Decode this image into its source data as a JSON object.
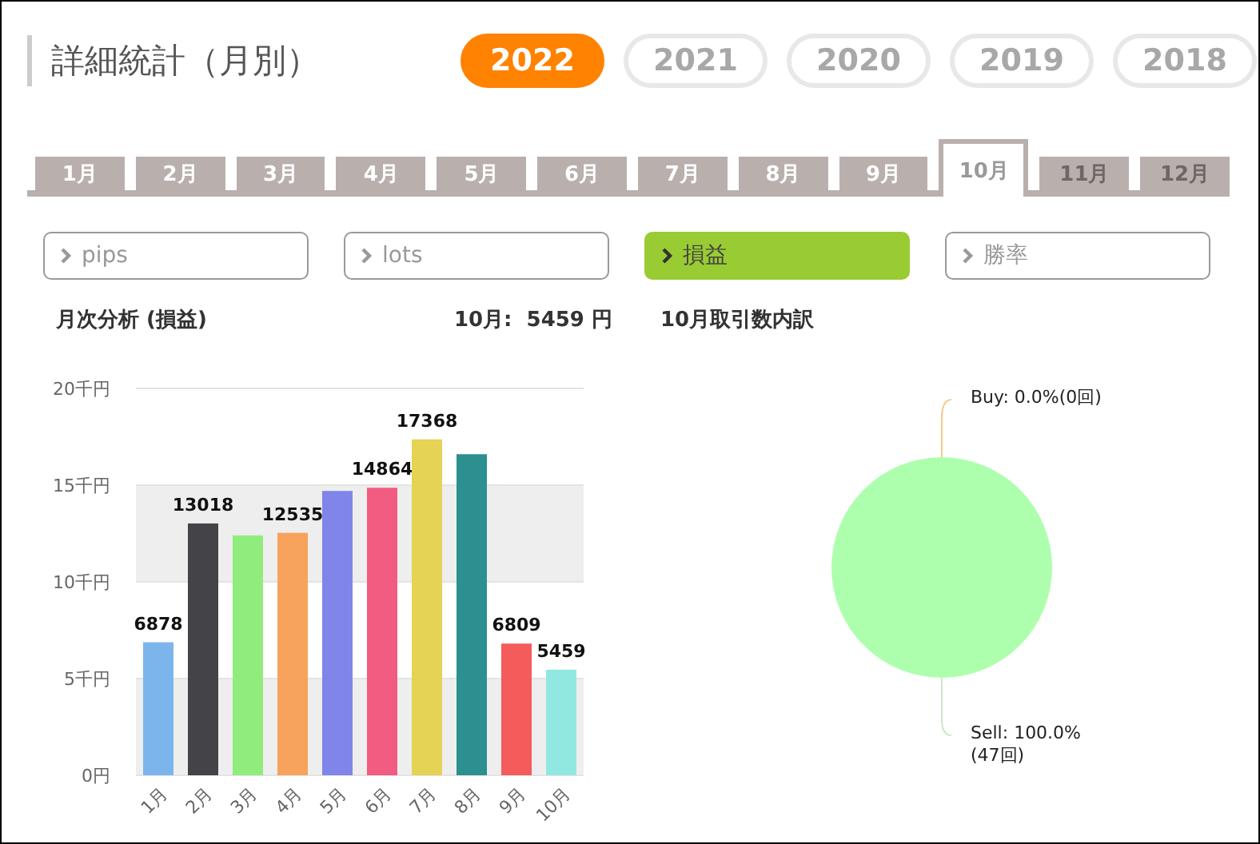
{
  "header": {
    "title": "詳細統計（月別）"
  },
  "years": [
    {
      "label": "2022",
      "selected": true
    },
    {
      "label": "2021",
      "selected": false
    },
    {
      "label": "2020",
      "selected": false
    },
    {
      "label": "2019",
      "selected": false
    },
    {
      "label": "2018",
      "selected": false
    }
  ],
  "months": [
    {
      "label": "1月",
      "selected": false,
      "disabled": false
    },
    {
      "label": "2月",
      "selected": false,
      "disabled": false
    },
    {
      "label": "3月",
      "selected": false,
      "disabled": false
    },
    {
      "label": "4月",
      "selected": false,
      "disabled": false
    },
    {
      "label": "5月",
      "selected": false,
      "disabled": false
    },
    {
      "label": "6月",
      "selected": false,
      "disabled": false
    },
    {
      "label": "7月",
      "selected": false,
      "disabled": false
    },
    {
      "label": "8月",
      "selected": false,
      "disabled": false
    },
    {
      "label": "9月",
      "selected": false,
      "disabled": false
    },
    {
      "label": "10月",
      "selected": true,
      "disabled": false
    },
    {
      "label": "11月",
      "selected": false,
      "disabled": true
    },
    {
      "label": "12月",
      "selected": false,
      "disabled": true
    }
  ],
  "metrics": [
    {
      "label": "pips",
      "selected": false
    },
    {
      "label": "lots",
      "selected": false
    },
    {
      "label": "損益",
      "selected": true
    },
    {
      "label": "勝率",
      "selected": false
    }
  ],
  "monthly_panel": {
    "title": "月次分析 (損益)",
    "summary": "10月:  5459 円",
    "chart_data": {
      "type": "bar",
      "categories": [
        "1月",
        "2月",
        "3月",
        "4月",
        "5月",
        "6月",
        "7月",
        "8月",
        "9月",
        "10月"
      ],
      "series": [
        {
          "colors": [
            "#7cb5ec",
            "#434348",
            "#90ed7d",
            "#f7a35c",
            "#8085e9",
            "#f15c80",
            "#e4d354",
            "#2b908f",
            "#f45b5b",
            "#91e8e1"
          ],
          "values": [
            6.878,
            13.018,
            12.4,
            12.535,
            14.7,
            14.864,
            17.368,
            16.6,
            6.809,
            5.459
          ]
        }
      ],
      "ylim": [
        0,
        20
      ],
      "grid": true,
      "yticks": [
        {
          "value": 0,
          "label": "0円"
        },
        {
          "value": 5,
          "label": "5千円"
        },
        {
          "value": 10,
          "label": "10千円"
        },
        {
          "value": 15,
          "label": "15千円"
        },
        {
          "value": 20,
          "label": "20千円"
        }
      ],
      "value_labels": [
        "6878",
        "13018",
        null,
        "12535",
        null,
        "14864",
        "17368",
        null,
        "6809",
        "5459"
      ]
    }
  },
  "breakdown_panel": {
    "title": "10月取引数内訳",
    "chart_data": {
      "type": "pie",
      "series": [
        {
          "colors": [
            "#f7c98a",
            "#adffad"
          ],
          "values": [
            0,
            100
          ]
        }
      ],
      "value_labels": [
        "Buy: 0.0%(0回)",
        "Sell: 100.0%(47回)"
      ]
    }
  }
}
